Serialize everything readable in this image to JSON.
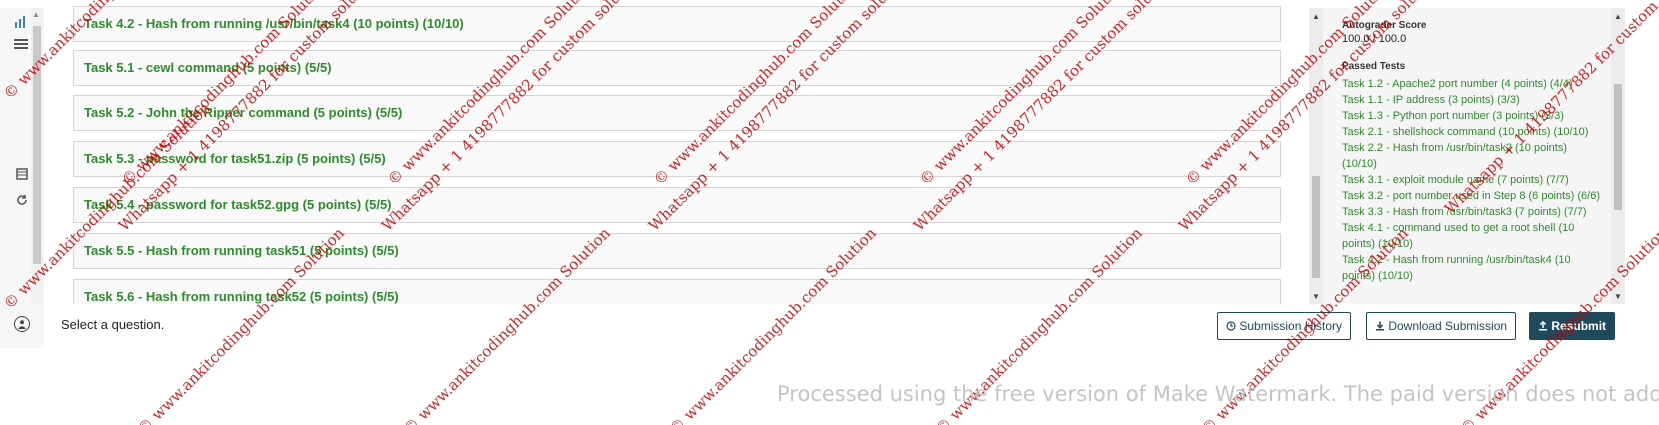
{
  "tasks": [
    "Task 4.2 - Hash from running /usr/bin/task4 (10 points) (10/10)",
    "Task 5.1 - cewl command (5 points) (5/5)",
    "Task 5.2 - John the Ripper command (5 points) (5/5)",
    "Task 5.3 - password for task51.zip (5 points) (5/5)",
    "Task 5.4 - password for task52.gpg (5 points) (5/5)",
    "Task 5.5 - Hash from running task51 (5 points) (5/5)",
    "Task 5.6 - Hash from running task52 (5 points) (5/5)"
  ],
  "score": {
    "label": "Autograder Score",
    "value": "100.0 / 100.0",
    "passed_label": "Passed Tests",
    "passed": [
      "Task 1.2 - Apache2 port number (4 points) (4/4)",
      "Task 1.1 - IP address (3 points) (3/3)",
      "Task 1.3 - Python port number (3 points) (3/3)",
      "Task 2.1 - shellshock command (10 points) (10/10)",
      "Task 2.2 - Hash from /usr/bin/task2 (10 points) (10/10)",
      "Task 3.1 - exploit module name (7 points) (7/7)",
      "Task 3.2 - port number used in Step 8 (6 points) (6/6)",
      "Task 3.3 - Hash from /usr/bin/task3 (7 points) (7/7)",
      "Task 4.1 - command used to get a root shell (10 points) (10/10)",
      "Task 4.2 - Hash from running /usr/bin/task4 (10 points) (10/10)"
    ]
  },
  "bottom": {
    "select_text": "Select a question.",
    "history_label": "Submission History",
    "download_label": "Download Submission",
    "resubmit_label": "Resubmit"
  },
  "icons": {
    "rail_top": "bar-chart-icon",
    "rail_menu": "hamburger-menu-icon",
    "rail_book": "book-icon",
    "rail_refresh": "refresh-icon",
    "user": "user-icon",
    "history": "clock-icon",
    "download": "download-icon",
    "upload": "upload-icon"
  },
  "watermark": {
    "line1": "© www.ankitcodinghub.com Solution",
    "line2": "Whatsapp + 1 4198777882 for custom solutions",
    "footer": "Processed using the free version of Make Watermark. The paid version does not add this mark."
  },
  "colors": {
    "task_green": "#2e8b2e",
    "button_dark": "#1e4a5c",
    "watermark_red": "#c80000"
  }
}
